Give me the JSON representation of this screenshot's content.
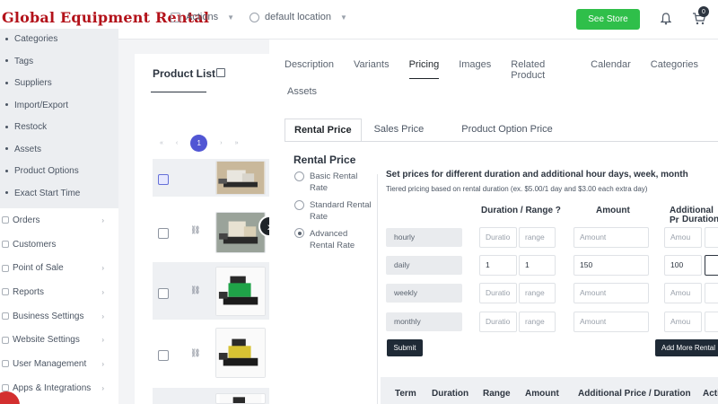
{
  "brand": "Global Equipment Rental",
  "topbar": {
    "actions": "Actions",
    "location": "default location",
    "see_store": "See Store",
    "cart_count": "0"
  },
  "sidebar": {
    "subitems": [
      "Categories",
      "Tags",
      "Suppliers",
      "Import/Export",
      "Restock",
      "Assets",
      "Product Options",
      "Exact Start Time"
    ],
    "items": [
      "Orders",
      "Customers",
      "Point of Sale",
      "Reports",
      "Business Settings",
      "Website Settings",
      "User Management",
      "Apps & Integrations"
    ]
  },
  "product_list": {
    "title": "Product List",
    "pager": {
      "first": "«",
      "prev": "‹",
      "current": "1",
      "next": "›",
      "last": "»"
    }
  },
  "tabs": [
    "Description",
    "Variants",
    "Pricing",
    "Images",
    "Related Product",
    "Calendar",
    "Categories",
    "Assets"
  ],
  "subtabs": [
    "Rental Price",
    "Sales Price",
    "Product Option Price"
  ],
  "rental_price": {
    "title": "Rental Price",
    "options": [
      "Basic Rental Rate",
      "Standard Rental Rate",
      "Advanced Rental Rate"
    ],
    "selected": "Advanced Rental Rate"
  },
  "pricing": {
    "heading": "Set prices for different duration and additional hour days, week, month",
    "subheading": "Tiered pricing based on rental duration (ex. $5.00/1 day and $3.00 each extra day)",
    "col_duration": "Duration / Range ?",
    "col_amount": "Amount",
    "col_additional_1": "Additional Pr",
    "col_additional_2": "Duration",
    "rows": [
      {
        "term": "hourly",
        "duration": "Duratio",
        "range": "range",
        "amount": "Amount",
        "add": "Amou"
      },
      {
        "term": "daily",
        "duration": "1",
        "range": "1",
        "amount": "150",
        "add": "100"
      },
      {
        "term": "weekly",
        "duration": "Duratio",
        "range": "range",
        "amount": "Amount",
        "add": "Amou"
      },
      {
        "term": "monthly",
        "duration": "Duratio",
        "range": "range",
        "amount": "Amount",
        "add": "Amou"
      }
    ],
    "submit": "Submit",
    "add_more": "Add More Rental"
  },
  "table_headers": [
    "Term",
    "Duration",
    "Range",
    "Amount",
    "Additional Price / Duration",
    "Acti"
  ],
  "colors": {
    "brand": "#b3121a",
    "green": "#2fbf4a",
    "accent": "#5156d4",
    "dark": "#1f2a36"
  }
}
